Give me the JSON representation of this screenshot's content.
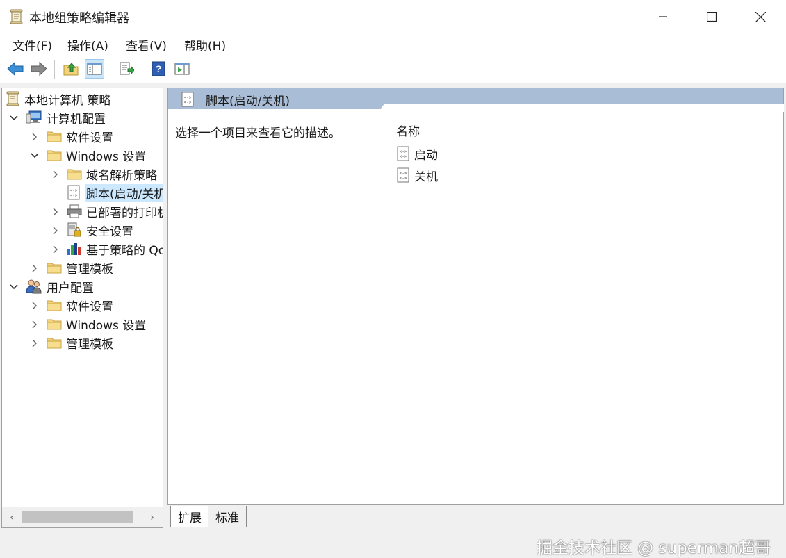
{
  "window": {
    "title": "本地组策略编辑器",
    "minimize_label": "Minimize",
    "maximize_label": "Maximize",
    "close_label": "Close"
  },
  "menu": [
    {
      "text": "文件(",
      "acc": "F",
      "end": ")"
    },
    {
      "text": "操作(",
      "acc": "A",
      "end": ")"
    },
    {
      "text": "查看(",
      "acc": "V",
      "end": ")"
    },
    {
      "text": "帮助(",
      "acc": "H",
      "end": ")"
    }
  ],
  "toolbar": {
    "icons": [
      "back-arrow-icon",
      "forward-arrow-icon",
      "up-folder-icon",
      "show-hide-tree-icon",
      "export-list-icon",
      "help-icon",
      "show-action-pane-icon"
    ]
  },
  "tree": {
    "root": "本地计算机 策略",
    "computer_config": "计算机配置",
    "software_settings": "软件设置",
    "windows_settings": "Windows 设置",
    "name_resolution": "域名解析策略",
    "scripts": "脚本(启动/关机)",
    "deployed_printers": "已部署的打印机",
    "security_settings": "安全设置",
    "policy_qos": "基于策略的 QoS",
    "admin_templates": "管理模板",
    "user_config": "用户配置",
    "user_software_settings": "软件设置",
    "user_windows_settings": "Windows 设置",
    "user_admin_templates": "管理模板"
  },
  "content": {
    "header": "脚本(启动/关机)",
    "description": "选择一个项目来查看它的描述。",
    "column_name": "名称",
    "items": [
      "启动",
      "关机"
    ]
  },
  "tabs": {
    "extended": "扩展",
    "standard": "标准"
  },
  "watermark": "掘金技术社区 @ superman超哥",
  "colors": {
    "header_bar": "#a9bdd7",
    "selection": "#cce8ff",
    "folder": "#f3d37b"
  }
}
